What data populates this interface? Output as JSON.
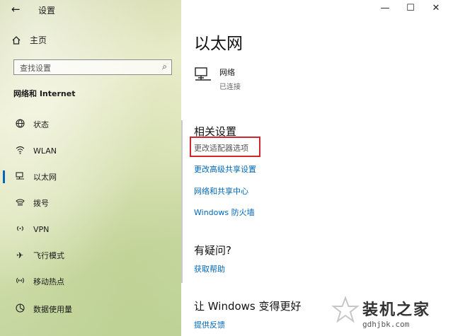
{
  "window": {
    "title": "设置",
    "back_label": "←",
    "minimize_label": "—",
    "maximize_label": "☐",
    "close_label": "✕"
  },
  "sidebar": {
    "home_label": "主页",
    "search_placeholder": "查找设置",
    "section_title": "网络和 Internet",
    "items": [
      {
        "label": "状态",
        "icon": "globe-icon"
      },
      {
        "label": "WLAN",
        "icon": "wifi-icon"
      },
      {
        "label": "以太网",
        "icon": "ethernet-icon"
      },
      {
        "label": "拨号",
        "icon": "dialup-icon"
      },
      {
        "label": "VPN",
        "icon": "vpn-icon"
      },
      {
        "label": "飞行模式",
        "icon": "airplane-icon"
      },
      {
        "label": "移动热点",
        "icon": "hotspot-icon"
      },
      {
        "label": "数据使用量",
        "icon": "data-usage-icon"
      }
    ],
    "active_index": 2
  },
  "main": {
    "title": "以太网",
    "network": {
      "name": "网络",
      "status": "已连接"
    },
    "related_title": "相关设置",
    "links": [
      {
        "label": "更改适配器选项",
        "highlighted": true
      },
      {
        "label": "更改高级共享设置",
        "highlighted": false
      },
      {
        "label": "网络和共享中心",
        "highlighted": false
      },
      {
        "label": "Windows 防火墙",
        "highlighted": false
      }
    ],
    "question_title": "有疑问?",
    "help_link": "获取帮助",
    "improve_title": "让 Windows 变得更好",
    "feedback_link": "提供反馈"
  },
  "watermark": {
    "text": "装机之家",
    "url": "gdhjbk.com"
  },
  "colors": {
    "accent": "#0067b8",
    "highlight": "#d2262f"
  }
}
